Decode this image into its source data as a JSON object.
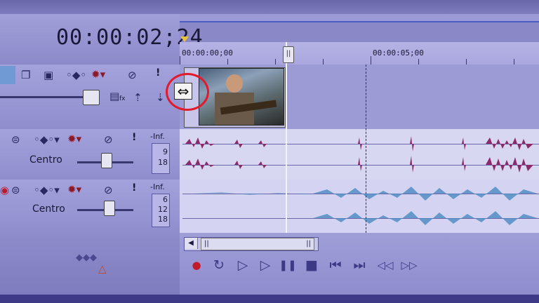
{
  "timecode": "00:00:02;24",
  "ruler": {
    "labels": [
      "00:00:00;00",
      "00:00:05;00"
    ]
  },
  "playhead_handle": "||",
  "video_track": {
    "icons": [
      "layers-icon",
      "composite-icon",
      "keyframe-icon",
      "gear-icon",
      "mute-icon",
      "solo-icon"
    ],
    "solo_label": "!",
    "fx_label": "fx"
  },
  "audio_track_1": {
    "pan_label": "Centro",
    "meter_top": "-Inf.",
    "meter_values": [
      "9",
      "18"
    ],
    "solo_label": "!"
  },
  "audio_track_2": {
    "pan_label": "Centro",
    "meter_top": "-Inf.",
    "meter_values": [
      "6",
      "12",
      "18"
    ],
    "solo_label": "!"
  },
  "colors": {
    "accent": "#4a5cc0",
    "annotation_circle": "#e11a2c",
    "waveform_a": "#8a2a6a",
    "waveform_b": "#4a8ac0",
    "transport": "#3c3a84"
  },
  "transport": {
    "record": "●",
    "loop": "↻",
    "play_from_start": "▷",
    "play": "▷",
    "pause": "❚❚",
    "stop": "■",
    "prev": "⏮",
    "next": "⏭",
    "rewind": "◁◁",
    "fast_forward": "▷▷"
  },
  "scroll": {
    "left_arrow": "◀",
    "thumb_grip": "||"
  },
  "resize_cursor": "⇔",
  "bottom_left": {
    "arrows": "◆◆◆",
    "warning": "△"
  }
}
